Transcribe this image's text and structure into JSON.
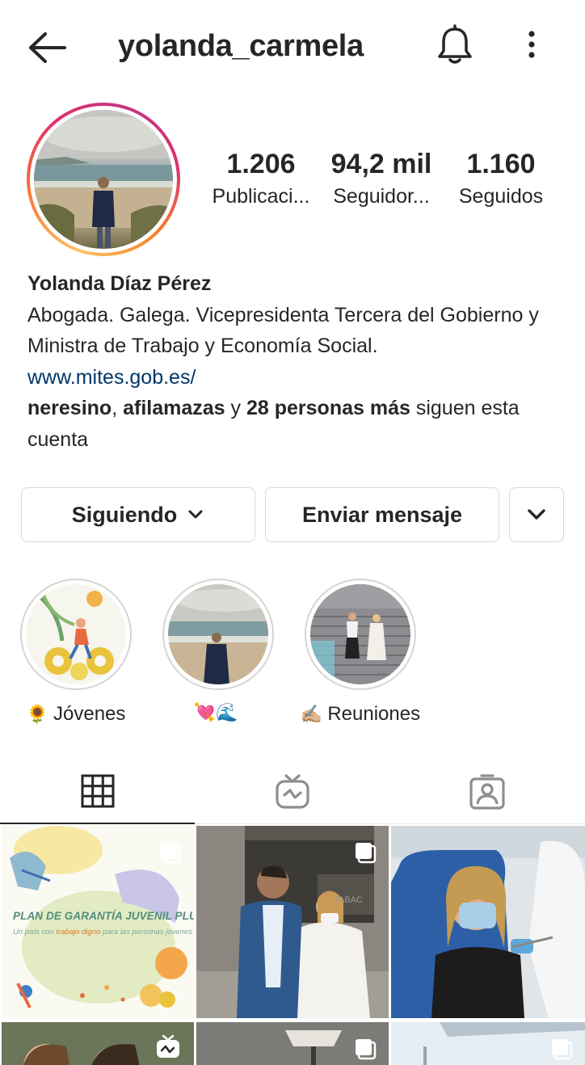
{
  "header": {
    "username": "yolanda_carmela",
    "icons": {
      "back": "arrow-left-icon",
      "notifications": "bell-icon",
      "more": "vertical-ellipsis-icon"
    }
  },
  "stats": [
    {
      "value": "1.206",
      "label": "Publicaci..."
    },
    {
      "value": "94,2 mil",
      "label": "Seguidor..."
    },
    {
      "value": "1.160",
      "label": "Seguidos"
    }
  ],
  "bio": {
    "name": "Yolanda Díaz Pérez",
    "description": "Abogada. Galega. Vicepresidenta Tercera del Gobierno y Ministra de Trabajo y Economía Social.",
    "link": "www.mites.gob.es/",
    "followed_by": {
      "user1": "neresino",
      "sep1": ", ",
      "user2": "afilamazas",
      "sep2": " y ",
      "others": "28 personas más",
      "suffix": " siguen esta cuenta"
    }
  },
  "actions": {
    "following_label": "Siguiendo",
    "message_label": "Enviar mensaje"
  },
  "highlights": [
    {
      "emoji": "🌻",
      "label": "Jóvenes"
    },
    {
      "emoji": "💘🌊",
      "label": ""
    },
    {
      "emoji": "✍🏼",
      "label": "Reuniones"
    }
  ],
  "tabs": [
    {
      "name": "grid",
      "icon": "grid-icon",
      "active": true
    },
    {
      "name": "igtv",
      "icon": "igtv-icon",
      "active": false
    },
    {
      "name": "tagged",
      "icon": "tagged-user-icon",
      "active": false
    }
  ],
  "posts": {
    "post1": {
      "title": "PLAN DE GARANTÍA JUVENIL PLUS",
      "subtitle_pre": "Un país con ",
      "subtitle_em": "trabajo digno",
      "subtitle_post": " para las personas jóvenes"
    },
    "post2_sign": "TABAC"
  },
  "colors": {
    "text": "#262626",
    "link": "#00376b",
    "border": "#d8d8d8",
    "ring_gradient": [
      "#fdc468",
      "#f77737",
      "#e1306c",
      "#c13584"
    ]
  }
}
